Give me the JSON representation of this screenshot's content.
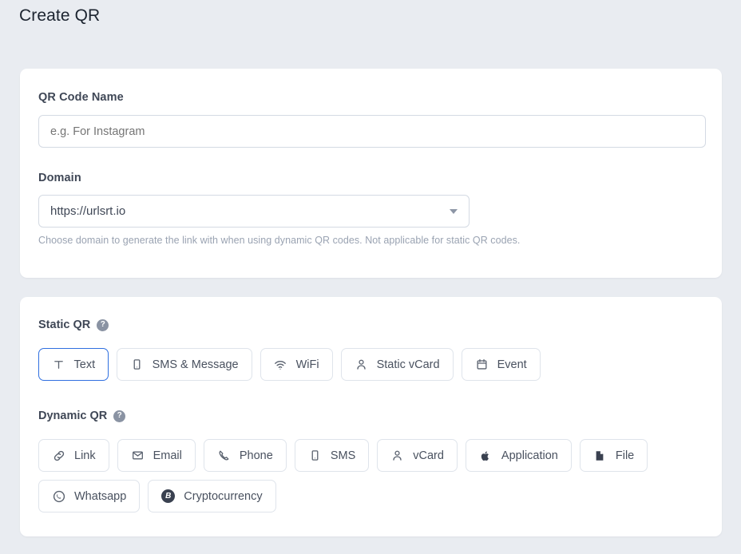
{
  "page": {
    "title": "Create QR",
    "background_color": "#e9ecf1",
    "card_color": "#ffffff",
    "accent_color": "#2f6fe0"
  },
  "details_card": {
    "name_field": {
      "label": "QR Code Name",
      "placeholder": "e.g. For Instagram",
      "value": ""
    },
    "domain_field": {
      "label": "Domain",
      "selected": "https://urlsrt.io",
      "helper": "Choose domain to generate the link with when using dynamic QR codes. Not applicable for static QR codes.",
      "caret_icon": "chevron-down-icon"
    }
  },
  "types_card": {
    "static": {
      "title": "Static QR",
      "help_icon": "help-icon",
      "help_glyph": "?",
      "options": [
        {
          "label": "Text",
          "icon": "text-icon",
          "selected": true
        },
        {
          "label": "SMS & Message",
          "icon": "mobile-icon",
          "selected": false
        },
        {
          "label": "WiFi",
          "icon": "wifi-icon",
          "selected": false
        },
        {
          "label": "Static vCard",
          "icon": "person-icon",
          "selected": false
        },
        {
          "label": "Event",
          "icon": "calendar-icon",
          "selected": false
        }
      ]
    },
    "dynamic": {
      "title": "Dynamic QR",
      "help_icon": "help-icon",
      "help_glyph": "?",
      "options": [
        {
          "label": "Link",
          "icon": "link-icon",
          "selected": false
        },
        {
          "label": "Email",
          "icon": "envelope-icon",
          "selected": false
        },
        {
          "label": "Phone",
          "icon": "phone-icon",
          "selected": false
        },
        {
          "label": "SMS",
          "icon": "mobile-icon",
          "selected": false
        },
        {
          "label": "vCard",
          "icon": "person-icon",
          "selected": false
        },
        {
          "label": "Application",
          "icon": "apple-icon",
          "selected": false
        },
        {
          "label": "File",
          "icon": "file-icon",
          "selected": false
        },
        {
          "label": "Whatsapp",
          "icon": "whatsapp-icon",
          "selected": false
        },
        {
          "label": "Cryptocurrency",
          "icon": "bitcoin-icon",
          "selected": false
        }
      ]
    }
  }
}
